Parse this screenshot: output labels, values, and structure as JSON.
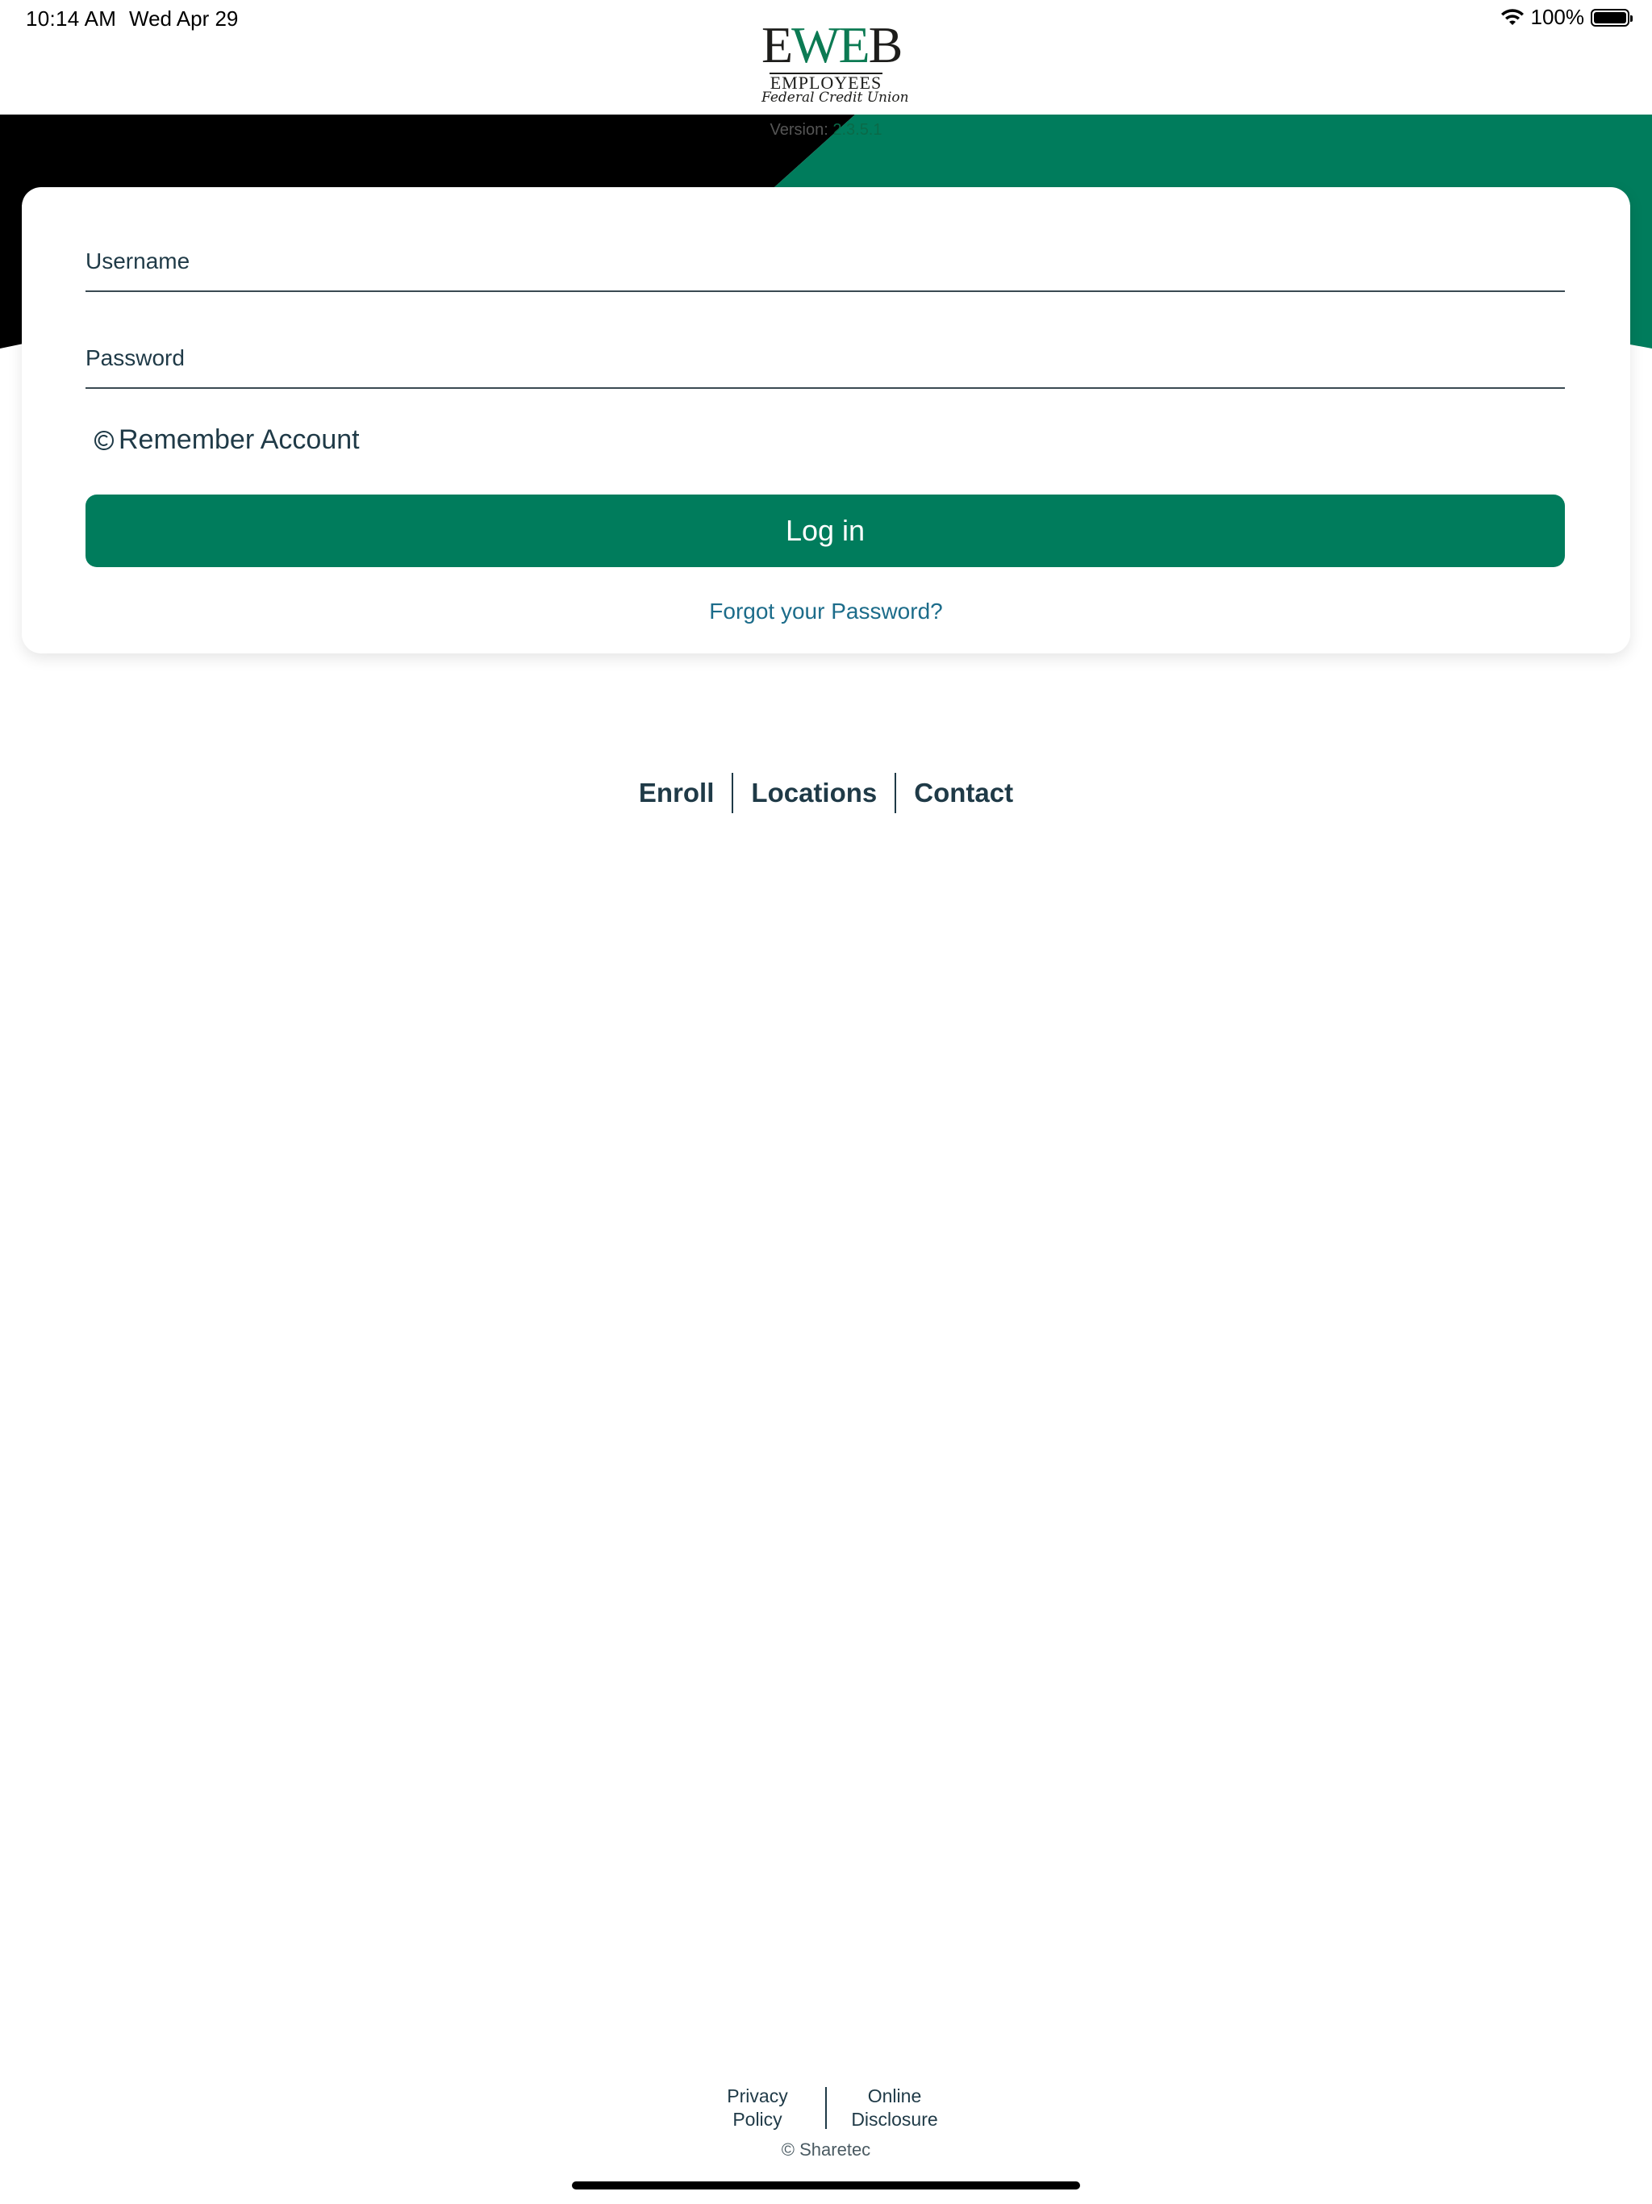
{
  "status_bar": {
    "time": "10:14 AM",
    "date": "Wed Apr 29",
    "battery_percent": "100%",
    "battery_level": 1.0,
    "wifi_icon": "wifi-icon",
    "battery_icon": "battery-icon"
  },
  "logo": {
    "word_prefix": "E",
    "word_highlight": "WE",
    "word_suffix": "B",
    "line1": "EMPLOYEES",
    "line2": "Federal Credit Union"
  },
  "version": {
    "label": "Version:",
    "number": "2.3.5.1"
  },
  "login": {
    "username_placeholder": "Username",
    "password_placeholder": "Password",
    "remember_label": "Remember Account",
    "remember_icon": "radio-unchecked-icon",
    "login_button": "Log in",
    "forgot_link": "Forgot your Password?"
  },
  "quick_links": [
    "Enroll",
    "Locations",
    "Contact"
  ],
  "footer": {
    "privacy_line1": "Privacy",
    "privacy_line2": "Policy",
    "disclosure_line1": "Online",
    "disclosure_line2": "Disclosure",
    "copyright": "© Sharetec"
  },
  "colors": {
    "brand_green": "#007c5c",
    "banner_black": "#000000",
    "text_dark": "#1f3a47",
    "link_blue": "#1c6c8a"
  }
}
